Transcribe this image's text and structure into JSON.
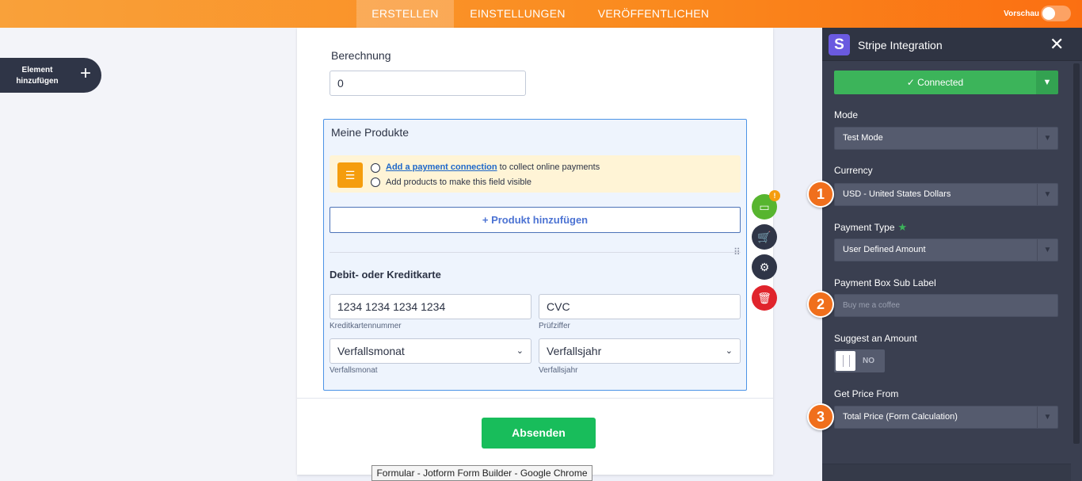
{
  "topbar": {
    "tabs": [
      {
        "label": "ERSTELLEN",
        "active": true
      },
      {
        "label": "EINSTELLUNGEN",
        "active": false
      },
      {
        "label": "VERÖFFENTLICHEN",
        "active": false
      }
    ],
    "preview_label": "Vorschau"
  },
  "left": {
    "add_element_label": "Element hinzufügen",
    "add_icon": "plus-icon"
  },
  "form": {
    "berechnung_label": "Berechnung",
    "berechnung_value": "0",
    "products_title": "Meine Produkte",
    "notice": {
      "icon": "checklist-icon",
      "link_text": "Add a payment connection",
      "line1_rest": " to collect online payments",
      "line2": "Add products to make this field visible"
    },
    "add_product_label": "+ Produkt hinzufügen",
    "card_title": "Debit- oder Kreditkarte",
    "card_number_placeholder": "1234 1234 1234 1234",
    "card_number_sublabel": "Kreditkartennummer",
    "cvc_placeholder": "CVC",
    "cvc_sublabel": "Prüfziffer",
    "month_value": "Verfallsmonat",
    "month_sublabel": "Verfallsmonat",
    "year_value": "Verfallsjahr",
    "year_sublabel": "Verfallsjahr",
    "submit_label": "Absenden",
    "side_badge": "!"
  },
  "tooltip": "Formular - Jotform Form Builder - Google Chrome",
  "panel": {
    "logo_letter": "S",
    "title": "Stripe Integration",
    "connected_label": "✓ Connected",
    "mode_label": "Mode",
    "mode_value": "Test Mode",
    "currency_label": "Currency",
    "currency_value": "USD - United States Dollars",
    "payment_type_label": "Payment Type",
    "payment_type_value": "User Defined Amount",
    "sub_label_label": "Payment Box Sub Label",
    "sub_label_placeholder": "Buy me a coffee",
    "suggest_label": "Suggest an Amount",
    "suggest_value": "NO",
    "price_from_label": "Get Price From",
    "price_from_value": "Total Price (Form Calculation)",
    "markers": [
      "1",
      "2",
      "3"
    ]
  },
  "colors": {
    "topbar_start": "#f9a13a",
    "topbar_end": "#fb6f12",
    "submit": "#18bd5b",
    "connected": "#3cb45a",
    "panel_bg": "#3a3f50",
    "marker": "#f06f1c",
    "link": "#1f68c9"
  }
}
